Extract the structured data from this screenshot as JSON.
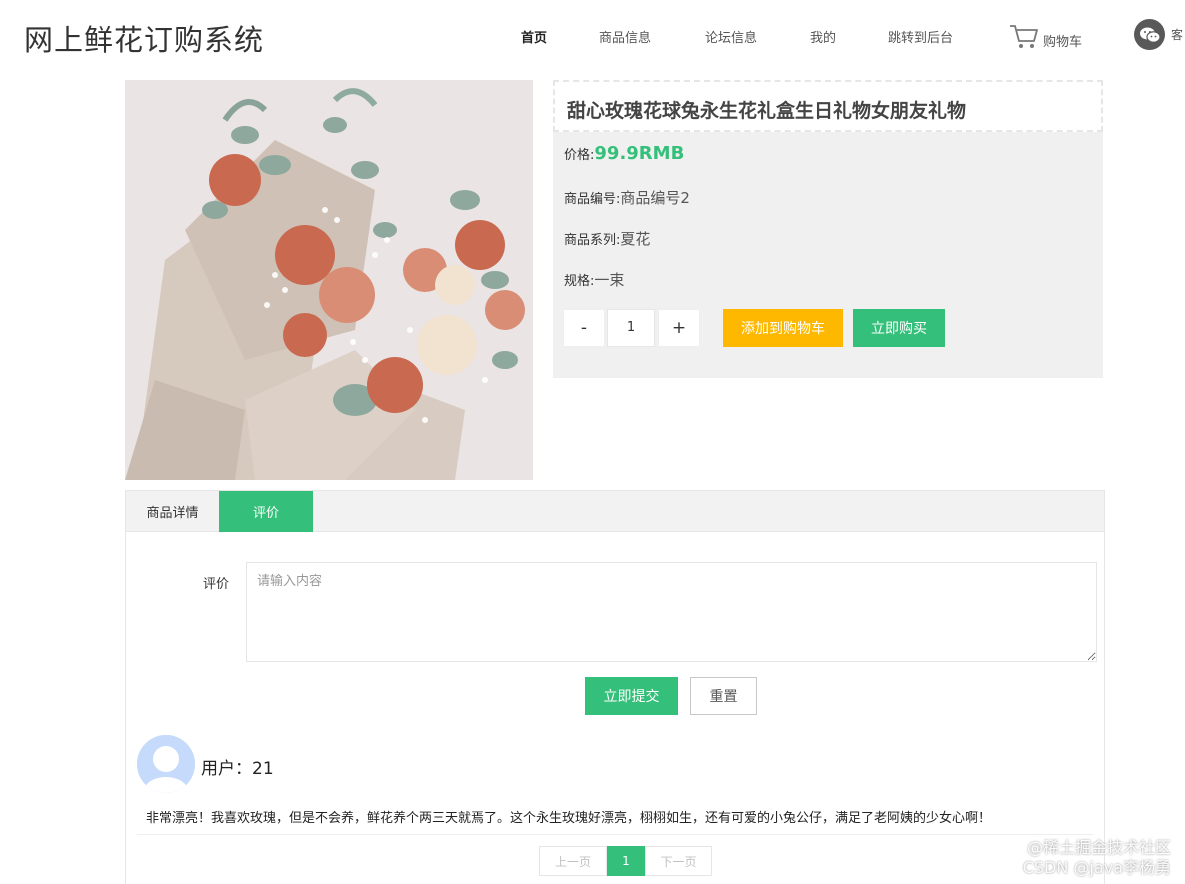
{
  "header": {
    "site_title": "网上鲜花订购系统",
    "nav": [
      {
        "label": "首页",
        "active": true
      },
      {
        "label": "商品信息",
        "active": false
      },
      {
        "label": "论坛信息",
        "active": false
      },
      {
        "label": "我的",
        "active": false
      },
      {
        "label": "跳转到后台",
        "active": false
      }
    ],
    "cart_label": "购物车",
    "cart_icon": "shopping-cart-icon",
    "service_label": "客",
    "service_icon": "wechat-icon"
  },
  "product": {
    "title": "甜心玫瑰花球兔永生花礼盒生日礼物女朋友礼物",
    "price_label": "价格:",
    "price": "99.9RMB",
    "code_label": "商品编号:",
    "code": "商品编号2",
    "series_label": "商品系列:",
    "series": "夏花",
    "spec_label": "规格:",
    "spec": "一束",
    "quantity": "1",
    "minus": "-",
    "plus": "+",
    "add_to_cart": "添加到购物车",
    "buy_now": "立即购买"
  },
  "tabs": [
    {
      "label": "商品详情",
      "active": false
    },
    {
      "label": "评价",
      "active": true
    }
  ],
  "review_form": {
    "label": "评价",
    "placeholder": "请输入内容",
    "submit": "立即提交",
    "reset": "重置"
  },
  "comments": [
    {
      "user": "用户：21",
      "text": "非常漂亮！我喜欢玫瑰，但是不会养，鲜花养个两三天就焉了。这个永生玫瑰好漂亮，栩栩如生，还有可爱的小兔公仔，满足了老阿姨的少女心啊！"
    }
  ],
  "pagination": {
    "prev": "上一页",
    "current": "1",
    "next": "下一页"
  },
  "watermark": {
    "line1": "@稀土掘金技术社区",
    "line2": "CSDN @java李杨勇"
  },
  "colors": {
    "accent_green": "#34c07a",
    "cart_yellow": "#ffb800",
    "panel_gray": "#f0f0f0"
  }
}
